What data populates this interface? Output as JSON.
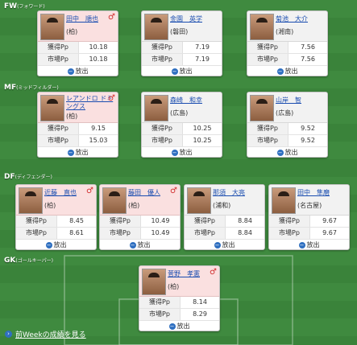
{
  "positions": {
    "fw": {
      "code": "FW",
      "sub": "(フォワード)"
    },
    "mf": {
      "code": "MF",
      "sub": "(ミッドフィルダー)"
    },
    "df": {
      "code": "DF",
      "sub": "(ディフェンダー)"
    },
    "gk": {
      "code": "GK",
      "sub": "(ゴールキーパー)"
    }
  },
  "labels": {
    "gain": "獲得Pp",
    "market": "市場Pp",
    "release": "放出",
    "male_symbol": "♂"
  },
  "players": [
    {
      "pos": "fw",
      "name": "田中　順也",
      "team": "(柏)",
      "gain": "10.18",
      "market": "10.18",
      "male": true
    },
    {
      "pos": "fw",
      "name": "金園　英学",
      "team": "(磐田)",
      "gain": "7.19",
      "market": "7.19",
      "male": false
    },
    {
      "pos": "fw",
      "name": "菊池　大介",
      "team": "(湘南)",
      "gain": "7.56",
      "market": "7.56",
      "male": false
    },
    {
      "pos": "mf",
      "name": "レアンドロ ドミングス",
      "team": "(柏)",
      "gain": "9.15",
      "market": "15.03",
      "male": true
    },
    {
      "pos": "mf",
      "name": "森崎　和幸",
      "team": "(広島)",
      "gain": "10.25",
      "market": "10.25",
      "male": false
    },
    {
      "pos": "mf",
      "name": "山岸　智",
      "team": "(広島)",
      "gain": "9.52",
      "market": "9.52",
      "male": false
    },
    {
      "pos": "df",
      "name": "近藤　直也",
      "team": "(柏)",
      "gain": "8.45",
      "market": "8.61",
      "male": true
    },
    {
      "pos": "df",
      "name": "藤田　優人",
      "team": "(柏)",
      "gain": "10.49",
      "market": "10.49",
      "male": true
    },
    {
      "pos": "df",
      "name": "那須　大亮",
      "team": "(浦和)",
      "gain": "8.84",
      "market": "8.84",
      "male": false
    },
    {
      "pos": "df",
      "name": "田中　隼磨",
      "team": "(名古屋)",
      "gain": "9.67",
      "market": "9.67",
      "male": false
    },
    {
      "pos": "gk",
      "name": "菅野　孝憲",
      "team": "(柏)",
      "gain": "8.14",
      "market": "8.29",
      "male": true
    }
  ],
  "footer": {
    "link": "前Weekの成績を見る"
  },
  "colors": {
    "male_card_header": "#fae0e0",
    "other_card_header": "#f2f2f2",
    "pitch": "#3f8a3f",
    "link": "#1a4db0"
  }
}
